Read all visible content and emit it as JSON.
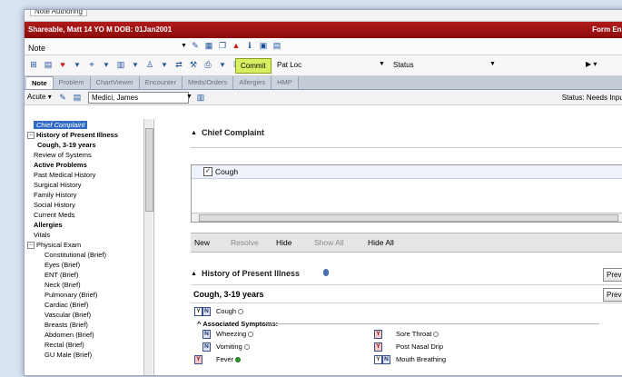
{
  "window": {
    "top_tab": "Note Authoring"
  },
  "banner": {
    "patient": "Shareable, Matt  14 YO  M DOB: 01Jan2001",
    "right_text": "Form Enc"
  },
  "note_type": {
    "value": "Note"
  },
  "toolbar": {
    "commit_label": "Commit",
    "patloc_label": "Pat Loc",
    "status_label": "Status"
  },
  "tabs": [
    {
      "label": "Note"
    },
    {
      "label": "Problem"
    },
    {
      "label": "ChartViewer"
    },
    {
      "label": "Encounter"
    },
    {
      "label": "Meds/Orders"
    },
    {
      "label": "Allergies"
    },
    {
      "label": "HMP"
    }
  ],
  "acute_bar": {
    "acute_label": "Acute",
    "provider": "Medici, James",
    "status_text": "Status:  Needs Input"
  },
  "sidebar": {
    "items": [
      {
        "label": "Chief Complaint",
        "selected": true
      },
      {
        "label": "History of Present Illness",
        "bold": true,
        "expander": "−"
      },
      {
        "label": "Cough, 3-19 years",
        "bold": true
      },
      {
        "label": "Review of Systems"
      },
      {
        "label": "Active Problems",
        "bold": true
      },
      {
        "label": "Past Medical History"
      },
      {
        "label": "Surgical History"
      },
      {
        "label": "Family History"
      },
      {
        "label": "Social History"
      },
      {
        "label": "Current Meds"
      },
      {
        "label": "Allergies",
        "bold": true
      },
      {
        "label": "Vitals"
      },
      {
        "label": "Physical Exam",
        "expander": "−"
      },
      {
        "label": "Constitutional (Brief)"
      },
      {
        "label": "Eyes (Brief)"
      },
      {
        "label": "ENT (Brief)"
      },
      {
        "label": "Neck (Brief)"
      },
      {
        "label": "Pulmonary (Brief)"
      },
      {
        "label": "Cardiac (Brief)"
      },
      {
        "label": "Vascular (Brief)"
      },
      {
        "label": "Breasts (Brief)"
      },
      {
        "label": "Abdomen (Brief)"
      },
      {
        "label": "Rectal (Brief)"
      },
      {
        "label": "GU Male (Brief)"
      }
    ]
  },
  "chief_complaint": {
    "header": "Chief Complaint",
    "entry": "Cough",
    "checked": true
  },
  "actions": {
    "new": "New",
    "resolve": "Resolve",
    "hide": "Hide",
    "show_all": "Show All",
    "hide_all": "Hide All"
  },
  "hpi": {
    "header": "History of Present Illness",
    "previous_label": "Previous",
    "case_title": "Cough, 3-19 years",
    "case_previous_label": "Previous",
    "cough_label": "Cough",
    "associated_label": "Associated Symptoms:",
    "symptoms_left": [
      {
        "label": "Wheezing",
        "state": "N",
        "dot": "empty"
      },
      {
        "label": "Vomiting",
        "state": "N",
        "dot": "empty"
      },
      {
        "label": "Fever",
        "state": "Y",
        "dot": "green"
      }
    ],
    "symptoms_right": [
      {
        "label": "Sore Throat",
        "state": "Y",
        "dot": "empty"
      },
      {
        "label": "Post Nasal Drip",
        "state": "Y",
        "dot": "none"
      },
      {
        "label": "Mouth Breathing",
        "state": "YN",
        "dot": "none"
      }
    ]
  },
  "colors": {
    "banner": "#a01414",
    "commit": "#d8f060",
    "selection": "#316ac5",
    "tab_bar": "#c4ccd8"
  }
}
